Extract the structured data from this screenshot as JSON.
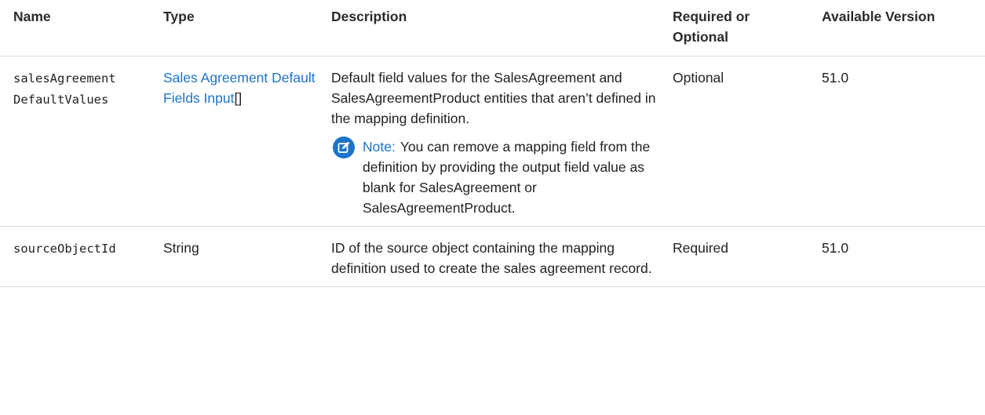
{
  "table": {
    "headers": {
      "name": "Name",
      "type": "Type",
      "description": "Description",
      "required": "Required or Optional",
      "version": "Available Version"
    },
    "rows": [
      {
        "name": "salesAgreement DefaultValues",
        "type_link": "Sales Agreement Default Fields Input",
        "type_suffix": "[]",
        "description": "Default field values for the SalesAgreement and SalesAgreementProduct entities that aren’t defined in the mapping definition.",
        "note_label": "Note:",
        "note_text": "You can remove a mapping field from the definition by providing the output field value as blank for SalesAgreement or SalesAgreementProduct.",
        "note_icon": "edit-note-icon",
        "required": "Optional",
        "version": "51.0"
      },
      {
        "name": "sourceObjectId",
        "type": "String",
        "description": "ID of the source object containing the mapping definition used to create the sales agreement record.",
        "required": "Required",
        "version": "51.0"
      }
    ]
  },
  "colors": {
    "link": "#1d73c9",
    "note_icon_bg": "#1d73c9",
    "border": "#d9d9d9"
  }
}
